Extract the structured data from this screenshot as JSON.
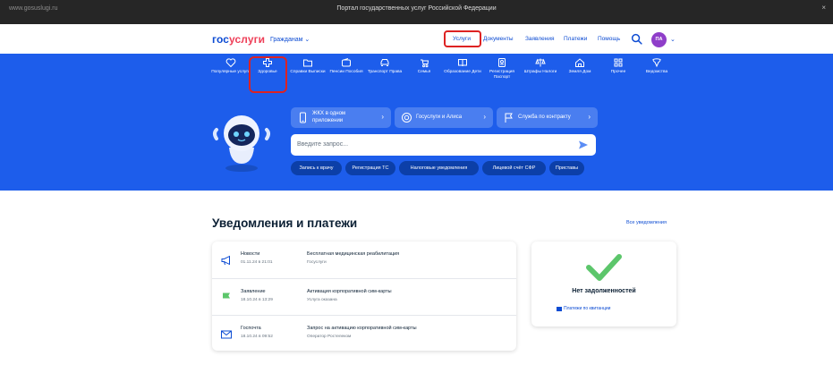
{
  "browser": {
    "url": "www.gosuslugi.ru",
    "title": "Портал государственных услуг Российской Федерации",
    "close_glyph": "×"
  },
  "header": {
    "logo_part1": "гос",
    "logo_part2": "услуги",
    "citizens_menu": "Гражданам ⌄",
    "nav": [
      "Услуги",
      "Документы",
      "Заявления",
      "Платежи",
      "Помощь"
    ],
    "avatar_initials": "ПА",
    "avatar_chevron": "⌄",
    "colors": {
      "brand_blue": "#0d4cd3",
      "brand_red": "#ee3f58",
      "avatar": "#8f3ec9",
      "highlight": "#dd2222"
    }
  },
  "hero": {
    "background": "#1d5deb",
    "categories": [
      {
        "label": "Популярные услуги",
        "icon": "heart-icon"
      },
      {
        "label": "Здоровье",
        "icon": "medical-cross-icon"
      },
      {
        "label": "Справки Выписки",
        "icon": "folder-icon"
      },
      {
        "label": "Пенсии Пособия",
        "icon": "wallet-icon"
      },
      {
        "label": "Транспорт Права",
        "icon": "car-icon"
      },
      {
        "label": "Семья",
        "icon": "stroller-icon"
      },
      {
        "label": "Образование Дети",
        "icon": "book-icon"
      },
      {
        "label": "Регистрация Паспорт",
        "icon": "passport-icon"
      },
      {
        "label": "Штрафы Налоги",
        "icon": "scales-icon"
      },
      {
        "label": "Земля Дом",
        "icon": "house-icon"
      },
      {
        "label": "Прочее",
        "icon": "grid-icon"
      },
      {
        "label": "Ведомства",
        "icon": "emblem-icon"
      }
    ],
    "promos": [
      {
        "label": "ЖКХ в одном приложении",
        "icon": "phone-icon",
        "chevron": "›"
      },
      {
        "label": "Госуслуги и Алиса",
        "icon": "alice-icon",
        "chevron": "›"
      },
      {
        "label": "Служба по контракту",
        "icon": "flag-icon",
        "chevron": "›"
      }
    ],
    "search_placeholder": "Введите запрос...",
    "chips": [
      "Запись к врачу",
      "Регистрация ТС",
      "Налоговые уведомления",
      "Лицевой счёт СФР",
      "Приставы"
    ]
  },
  "notifications": {
    "title": "Уведомления и платежи",
    "all_link": "Все уведомления",
    "rows": [
      {
        "type": "Новости",
        "date": "01.11.24 в 21:01",
        "message": "Бесплатная медицинская реабилитация",
        "source": "Госуслуги",
        "icon": "megaphone-icon"
      },
      {
        "type": "Заявление",
        "date": "18.10.24 в 13:29",
        "message": "Активация корпоративной сим-карты",
        "source": "Услуга оказана",
        "icon": "flag-icon"
      },
      {
        "type": "Госпочта",
        "date": "18.10.24 в 09:52",
        "message": "Запрос на активацию корпоративной сим-карты",
        "source": "Оператор Ростелеком",
        "icon": "envelope-icon"
      }
    ]
  },
  "debts": {
    "title": "Нет задолженностей",
    "link": "Платежи по квитанции",
    "check_color": "#5cc66b"
  }
}
